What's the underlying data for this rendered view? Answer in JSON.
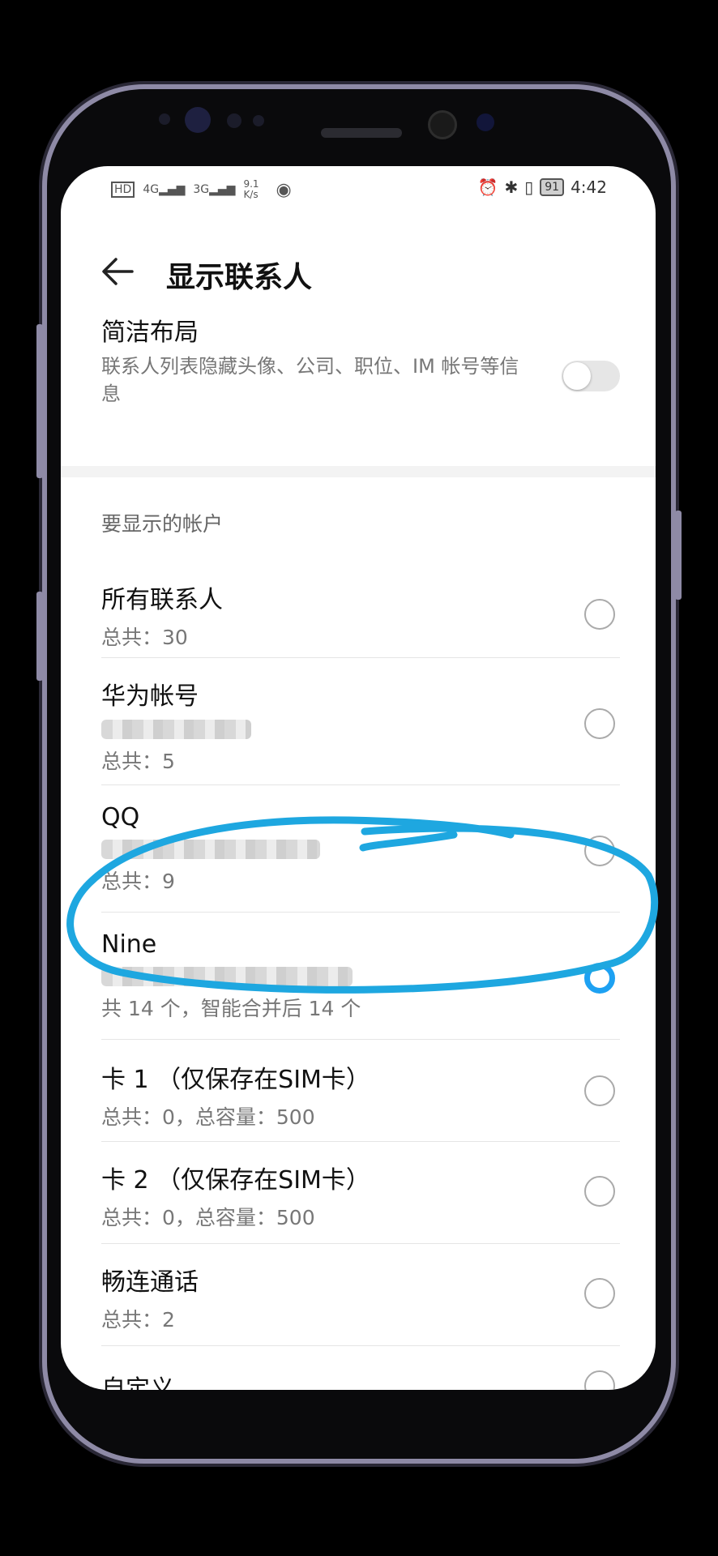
{
  "status": {
    "left_icons": [
      "HD",
      "4G",
      "3G",
      "9.1 K/s",
      "eye-comfort"
    ],
    "time": "4:42",
    "battery": "91"
  },
  "header": {
    "title": "显示联系人"
  },
  "simple_layout": {
    "title": "简洁布局",
    "description": "联系人列表隐藏头像、公司、职位、IM 帐号等信息",
    "enabled": false
  },
  "section_title": "要显示的帐户",
  "accounts": [
    {
      "title": "所有联系人",
      "sub": "总共：30",
      "selected": false
    },
    {
      "title": "华为帐号",
      "sub": "总共：5",
      "selected": false
    },
    {
      "title": "QQ",
      "sub": "总共：9",
      "selected": false
    },
    {
      "title": "Nine",
      "sub": "共 14 个，智能合并后 14 个",
      "selected": true
    },
    {
      "title": "卡 1 （仅保存在SIM卡）",
      "sub": "总共：0，总容量：500",
      "selected": false
    },
    {
      "title": "卡 2 （仅保存在SIM卡）",
      "sub": "总共：0，总容量：500",
      "selected": false
    },
    {
      "title": "畅连通话",
      "sub": "总共：2",
      "selected": false
    },
    {
      "title": "自定义",
      "sub": "",
      "selected": false
    }
  ],
  "colors": {
    "accent": "#1da1f2",
    "annotation": "#1ea7e0"
  }
}
